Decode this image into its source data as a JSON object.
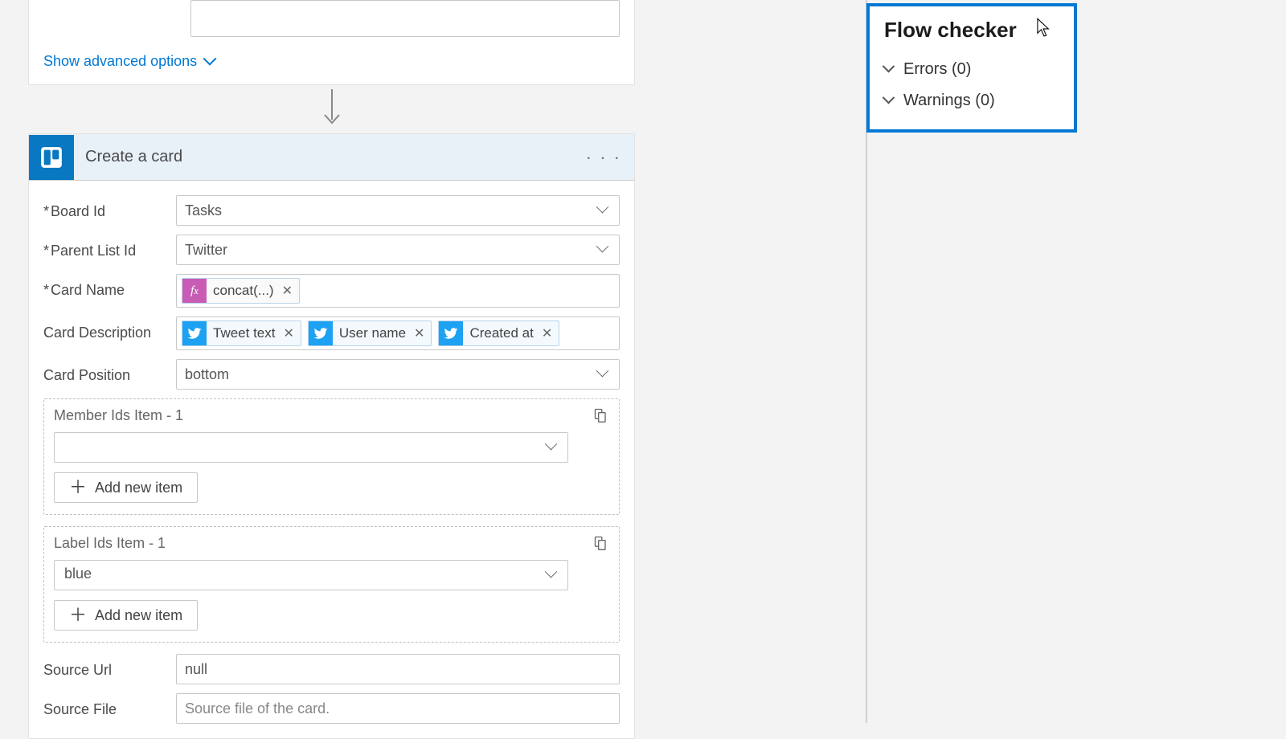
{
  "prev_action": {
    "advanced_toggle_label": "Show advanced options"
  },
  "action": {
    "title": "Create a card",
    "fields": {
      "board_id": {
        "label": "Board Id",
        "required": true,
        "value": "Tasks"
      },
      "parent_list_id": {
        "label": "Parent List Id",
        "required": true,
        "value": "Twitter"
      },
      "card_name": {
        "label": "Card Name",
        "required": true,
        "tokens": [
          {
            "type": "fx",
            "text": "concat(...)"
          }
        ]
      },
      "card_description": {
        "label": "Card Description",
        "tokens": [
          {
            "type": "tw",
            "text": "Tweet text"
          },
          {
            "type": "tw",
            "text": "User name"
          },
          {
            "type": "tw",
            "text": "Created at"
          }
        ]
      },
      "card_position": {
        "label": "Card Position",
        "value": "bottom"
      },
      "member_ids": {
        "group_label": "Member Ids Item - 1",
        "value": "",
        "add_label": "Add new item"
      },
      "label_ids": {
        "group_label": "Label Ids Item - 1",
        "value": "blue",
        "add_label": "Add new item"
      },
      "source_url": {
        "label": "Source Url",
        "value": "null"
      },
      "source_file": {
        "label": "Source File",
        "placeholder": "Source file of the card."
      }
    }
  },
  "flow_checker": {
    "title": "Flow checker",
    "errors_label": "Errors (0)",
    "warnings_label": "Warnings (0)"
  }
}
